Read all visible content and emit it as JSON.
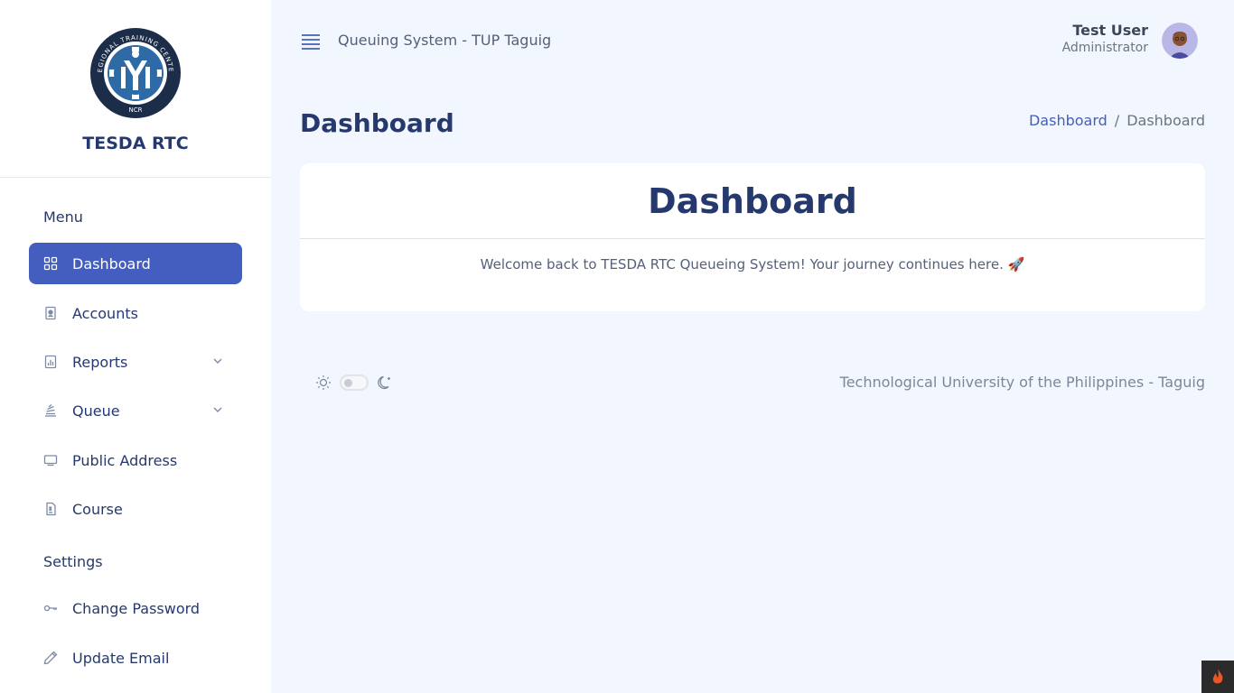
{
  "sidebar": {
    "brand": "TESDA RTC",
    "logo_text": {
      "top": "REGIONAL TRAINING CENTER",
      "bottom": "NCR"
    },
    "menu_title": "Menu",
    "items": [
      {
        "label": "Dashboard",
        "icon": "grid-icon",
        "active": true
      },
      {
        "label": "Accounts",
        "icon": "id-badge-icon"
      },
      {
        "label": "Reports",
        "icon": "bar-chart-icon",
        "expandable": true
      },
      {
        "label": "Queue",
        "icon": "stack-icon",
        "expandable": true
      },
      {
        "label": "Public Address",
        "icon": "monitor-icon"
      },
      {
        "label": "Course",
        "icon": "file-icon"
      }
    ],
    "settings_title": "Settings",
    "settings_items": [
      {
        "label": "Change Password",
        "icon": "key-icon"
      },
      {
        "label": "Update Email",
        "icon": "pencil-icon"
      }
    ]
  },
  "header": {
    "app_title": "Queuing System - TUP Taguig",
    "user_name": "Test User",
    "user_role": "Administrator"
  },
  "page": {
    "title": "Dashboard",
    "breadcrumb": [
      "Dashboard",
      "Dashboard"
    ]
  },
  "card": {
    "title": "Dashboard",
    "message": "Welcome back to TESDA RTC Queueing System! Your journey continues here. 🚀"
  },
  "footer": {
    "text": "Technological University of the Philippines - Taguig"
  },
  "colors": {
    "primary": "#435ebe",
    "heading": "#25396f",
    "background": "#f2f7ff"
  }
}
